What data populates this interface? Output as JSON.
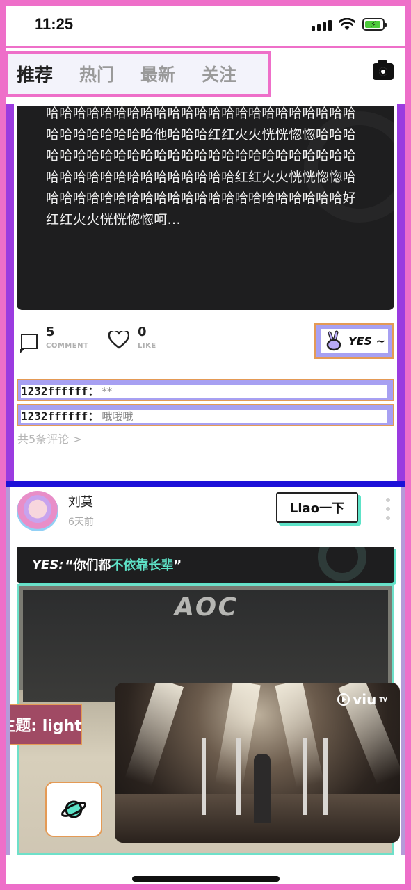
{
  "status_bar": {
    "time": "11:25"
  },
  "tabs": [
    {
      "label": "推荐",
      "active": true
    },
    {
      "label": "热门",
      "active": false
    },
    {
      "label": "最新",
      "active": false
    },
    {
      "label": "关注",
      "active": false
    }
  ],
  "post1": {
    "text": "哈哈哈哈哈哈哈哈哈哈哈哈哈哈哈哈哈哈哈哈哈哈哈哈哈哈哈哈哈哈哈他哈哈哈红红火火恍恍惚惚哈哈哈哈哈哈哈哈哈哈哈哈哈哈哈哈哈哈哈哈哈哈哈哈哈哈哈哈哈哈哈哈哈哈哈哈哈哈哈哈红红火火恍恍惚惚哈哈哈哈哈哈哈哈哈哈哈哈哈哈哈哈哈哈哈哈哈哈哈好红红火火恍恍惚惚呵...",
    "comment_count": "5",
    "comment_label": "COMMENT",
    "like_count": "0",
    "like_label": "LIKE",
    "yes_label": "YES ~",
    "comments": [
      {
        "user": "1232ffffff：",
        "text": "**"
      },
      {
        "user": "1232ffffff：",
        "text": "哦哦哦"
      }
    ],
    "all_comments": "共5条评论 >"
  },
  "post2": {
    "username": "刘莫",
    "time_ago": "6天前",
    "liao_button": "Liao一下",
    "quote_prefix": "YES:",
    "quote_open": "“你们都",
    "quote_highlight": "不依靠长辈",
    "quote_close": "”",
    "monitor_brand": "AOC"
  },
  "theme_tag": "主题: light",
  "video": {
    "brand": "viu",
    "brand_sup": "TV"
  },
  "colors": {
    "accent": "#5ee3c8",
    "frame_pink": "#ee6fc9",
    "frame_purple": "#9b3be0",
    "highlight_violet": "#a7a0f2"
  },
  "icons": [
    "camera-icon",
    "comment-icon",
    "heart-icon",
    "peace-hand-icon",
    "more-icon",
    "planet-icon",
    "play-icon"
  ]
}
